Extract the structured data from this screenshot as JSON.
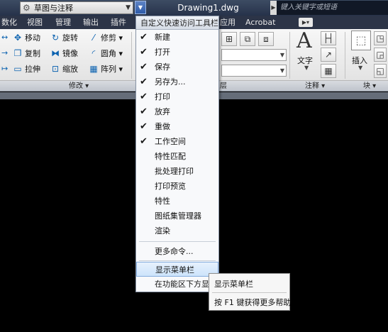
{
  "titlebar": {
    "workspace": "草图与注释",
    "document_title": "Drawing1.dwg",
    "search_placeholder": "键入关键字或短语"
  },
  "tabs": [
    "数化",
    "视图",
    "管理",
    "输出",
    "插件",
    "应用",
    "Acrobat"
  ],
  "ribbon": {
    "modify_tools": [
      {
        "icon": "move-icon",
        "label": "移动"
      },
      {
        "icon": "rotate-icon",
        "label": "旋转"
      },
      {
        "icon": "trim-icon",
        "label": "修剪"
      },
      {
        "icon": "copy-icon",
        "label": "复制"
      },
      {
        "icon": "mirror-icon",
        "label": "镜像"
      },
      {
        "icon": "fillet-icon",
        "label": "圆角"
      },
      {
        "icon": "stretch-icon",
        "label": "拉伸"
      },
      {
        "icon": "scale-icon",
        "label": "缩放"
      },
      {
        "icon": "array-icon",
        "label": "阵列"
      }
    ],
    "text_label": "文字",
    "insert_label": "插入",
    "panel_titles": {
      "modify": "修改",
      "layers_suffix": "层",
      "annotation": "注释",
      "block": "块"
    }
  },
  "qat_menu": {
    "header": "自定义快速访问工具栏",
    "items": [
      {
        "label": "新建",
        "checked": true
      },
      {
        "label": "打开",
        "checked": true
      },
      {
        "label": "保存",
        "checked": true
      },
      {
        "label": "另存为...",
        "checked": true
      },
      {
        "label": "打印",
        "checked": true
      },
      {
        "label": "放弃",
        "checked": true
      },
      {
        "label": "重做",
        "checked": true
      },
      {
        "label": "工作空间",
        "checked": true
      },
      {
        "label": "特性匹配",
        "checked": false
      },
      {
        "label": "批处理打印",
        "checked": false
      },
      {
        "label": "打印预览",
        "checked": false
      },
      {
        "label": "特性",
        "checked": false
      },
      {
        "label": "图纸集管理器",
        "checked": false
      },
      {
        "label": "渲染",
        "checked": false
      }
    ],
    "more_commands": "更多命令...",
    "show_menubar": "显示菜单栏",
    "show_below_ribbon": "在功能区下方显示"
  },
  "submenu": {
    "item": "显示菜单栏",
    "help": "按 F1 键获得更多帮助"
  },
  "colors": {
    "title_bg": "#26324a",
    "highlight": "#cde4fb",
    "canvas": "#000000"
  }
}
